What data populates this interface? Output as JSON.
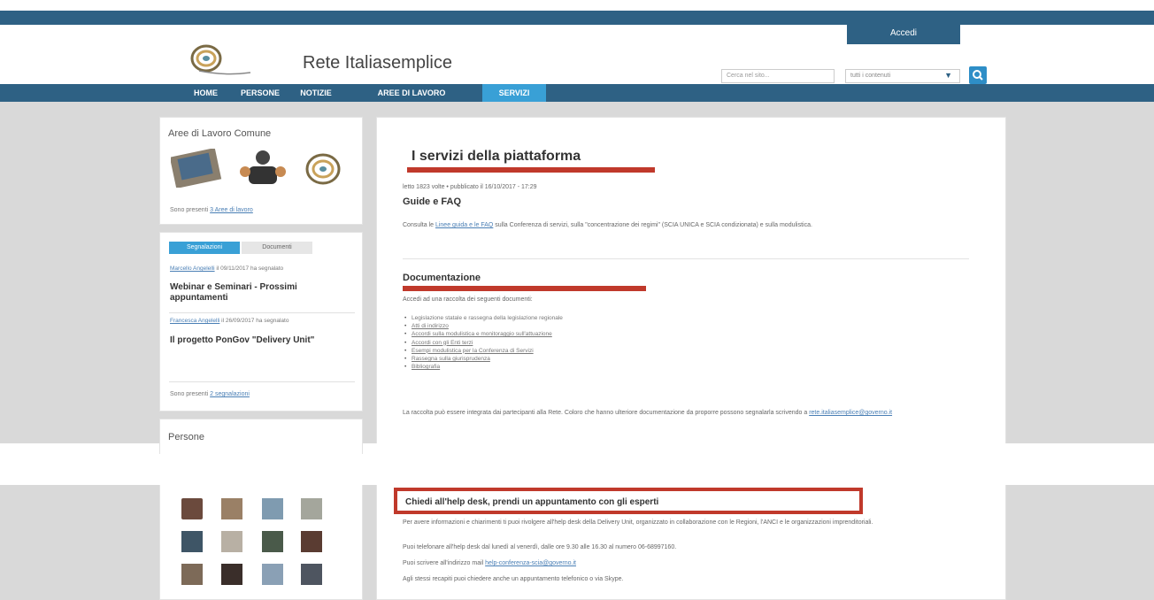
{
  "header": {
    "accedi_label": "Accedi",
    "site_title": "Rete Italiasemplice",
    "search_placeholder": "Cerca nel sito...",
    "scope_value": "tutti i contenuti",
    "scope_arrow": "▼"
  },
  "nav": {
    "items": [
      "HOME",
      "PERSONE",
      "NOTIZIE",
      "AREE DI LAVORO",
      "SERVIZI"
    ]
  },
  "sidebar": {
    "aree_title": "Aree di Lavoro Comune",
    "aree_count_prefix": "Sono presenti ",
    "aree_count_link": "3 Aree di lavoro",
    "tabs": [
      "Segnalazioni",
      "Documenti"
    ],
    "reports": [
      {
        "meta_link": "Marcello Angelelli",
        "meta_rest": " il 09/11/2017 ha segnalato",
        "title": "Webinar e Seminari - Prossimi appuntamenti"
      },
      {
        "meta_link": "Francesca Angelelli",
        "meta_rest": " il 26/09/2017 ha segnalato",
        "title": "Il progetto PonGov \"Delivery Unit\""
      }
    ],
    "reports_count_prefix": "Sono presenti ",
    "reports_count_link": "2 segnalazioni",
    "persone_title": "Persone"
  },
  "main": {
    "title": "I servizi della piattaforma",
    "meta": "letto 1823 volte • pubblicato il 16/10/2017 - 17:29",
    "guide_title": "Guide e FAQ",
    "guide_text_1": "Consulta le ",
    "guide_link": "Linee guida e le FAQ",
    "guide_text_2": " sulla Conferenza di servizi, sulla \"concentrazione dei regimi\" (SCIA UNICA e SCIA condizionata) e sulla modulistica.",
    "doc_title": "Documentazione",
    "doc_intro": "Accedi ad una raccolta dei seguenti documenti:",
    "doc_items": [
      "Legislazione statale e rassegna della legislazione regionale",
      "Atti di indirizzo",
      "Accordi sulla modulistica e monitoraggio sull'attuazione",
      "Accordi con gli Enti terzi",
      "Esempi modulistica per la Conferenza di Servizi",
      "Rassegna sulla giurisprudenza",
      "Bibliografia"
    ],
    "doc_note_1": "La raccolta può essere integrata dai partecipanti alla Rete. Coloro che hanno ulteriore documentazione da proporre possono segnalarla scrivendo a ",
    "doc_note_link": "rete.italiasemplice@governo.it",
    "helpdesk_title": "Chiedi all'help desk, prendi un appuntamento con gli esperti",
    "helpdesk_p1": "Per avere informazioni e chiarimenti ti puoi rivolgere all'help desk della Delivery Unit, organizzato in collaborazione con le Regioni, l'ANCI e le organizzazioni imprenditoriali.",
    "helpdesk_p2": "Puoi telefonare all'help desk dal lunedì al venerdì, dalle ore 9.30 alle 16.30 al numero 06-68997160.",
    "helpdesk_p3_1": "Puoi scrivere all'indirizzo mail ",
    "helpdesk_p3_link": "help-conferenza-scia@governo.it",
    "helpdesk_p4": "Agli stessi recapiti puoi chiedere anche un appuntamento telefonico o via Skype."
  },
  "colors": {
    "brand_blue": "#2e6184",
    "accent_blue": "#39a0d6",
    "highlight_red": "#c0392b"
  }
}
